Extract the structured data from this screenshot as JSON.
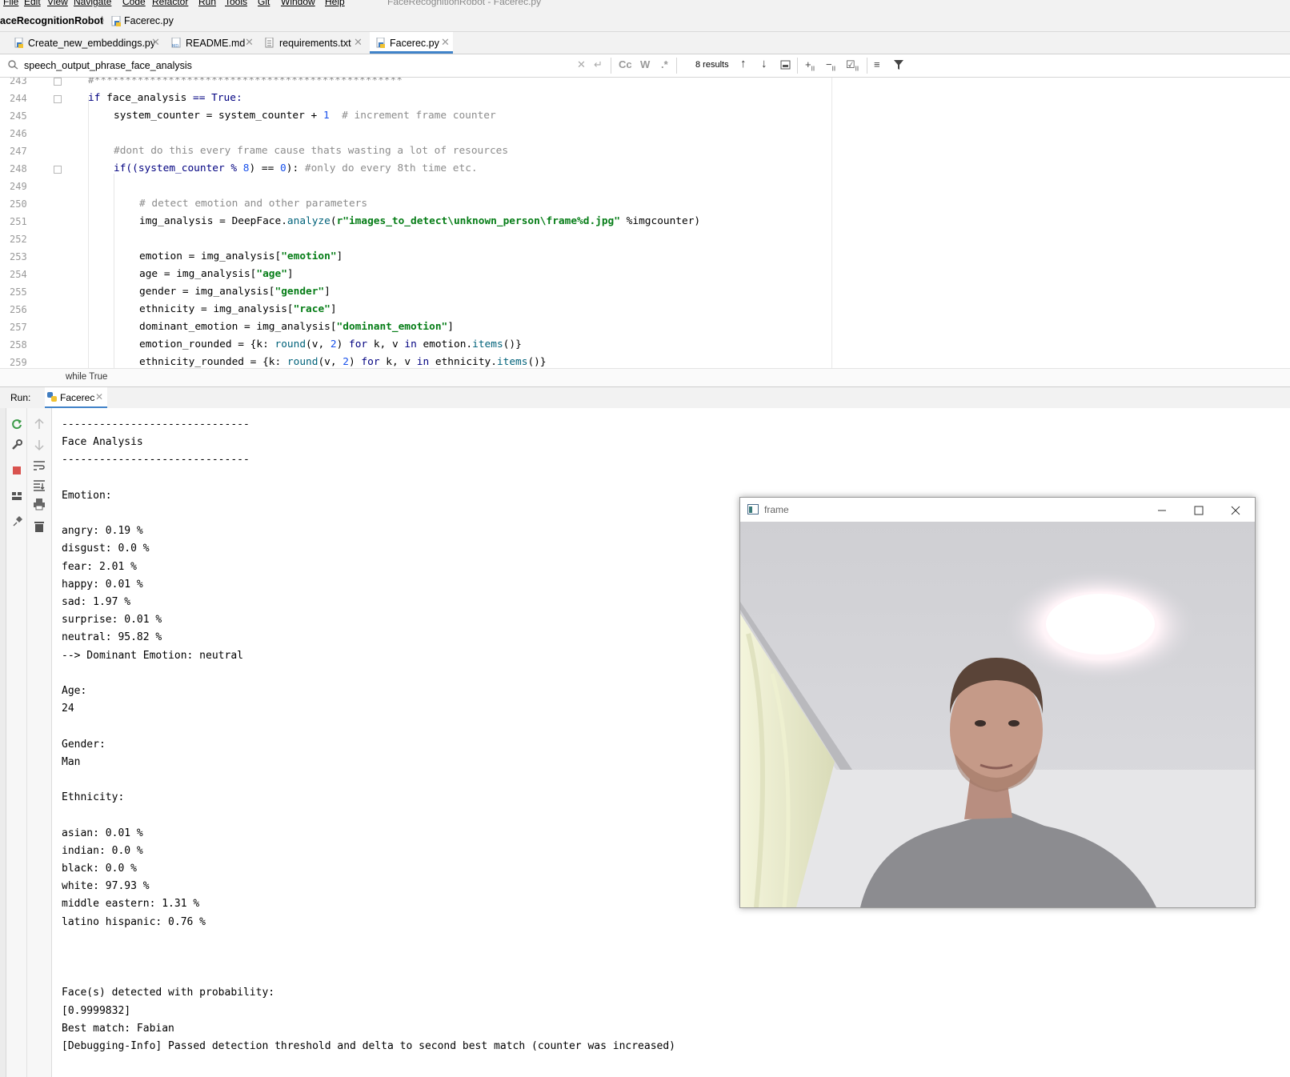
{
  "menu": {
    "items": [
      "File",
      "Edit",
      "View",
      "Navigate",
      "Code",
      "Refactor",
      "Run",
      "Tools",
      "Git",
      "Window",
      "Help"
    ],
    "window_title": "FaceRecognitionRobot - Facerec.py"
  },
  "breadcrumb": {
    "project": "aceRecognitionRobot",
    "file": "Facerec.py"
  },
  "tabs": [
    {
      "label": "Create_new_embeddings.py"
    },
    {
      "label": "README.md"
    },
    {
      "label": "requirements.txt"
    },
    {
      "label": "Facerec.py"
    }
  ],
  "search": {
    "value": "speech_output_phrase_face_analysis",
    "results": "8 results",
    "case_label": "Cc",
    "word_label": "W",
    "regex_label": ".*"
  },
  "editor": {
    "line_numbers": [
      "243",
      "244",
      "245",
      "246",
      "247",
      "248",
      "249",
      "250",
      "251",
      "252",
      "253",
      "254",
      "255",
      "256",
      "257",
      "258",
      "259"
    ],
    "lines": {
      "l243": "#**************************************************",
      "l244a": "if",
      "l244b": " face_analysis ",
      "l244c": "==",
      "l244d": " True:",
      "l245a": "system_counter = system_counter + ",
      "l245b": "1",
      "l245c": "  # increment frame counter",
      "l247": "#dont do this every frame cause thats wasting a lot of resources",
      "l248a": "if((system_counter % ",
      "l248b": "8",
      "l248c": ") == ",
      "l248d": "0",
      "l248e": "): ",
      "l248f": "#only do every 8th time etc.",
      "l250": "# detect emotion and other parameters",
      "l251a": "img_analysis = DeepFace.",
      "l251b": "analyze",
      "l251c": "(",
      "l251d": "r\"images_to_detect\\unknown_person\\frame%d.jpg\"",
      "l251e": " %imgcounter)",
      "l253a": "emotion = img_analysis[",
      "l253b": "\"emotion\"",
      "l253c": "]",
      "l254a": "age = img_analysis[",
      "l254b": "\"age\"",
      "l254c": "]",
      "l255a": "gender = img_analysis[",
      "l255b": "\"gender\"",
      "l255c": "]",
      "l256a": "ethnicity = img_analysis[",
      "l256b": "\"race\"",
      "l256c": "]",
      "l257a": "dominant_emotion = img_analysis[",
      "l257b": "\"dominant_emotion\"",
      "l257c": "]",
      "l258a": "emotion_rounded = {k: ",
      "l258b": "round",
      "l258c": "(v, ",
      "l258d": "2",
      "l258e": ") ",
      "l258f": "for",
      "l258g": " k, v ",
      "l258h": "in",
      "l258i": " emotion.",
      "l258j": "items",
      "l258k": "()}",
      "l259a": "ethnicity_rounded = {k: ",
      "l259b": "round",
      "l259c": "(v, ",
      "l259d": "2",
      "l259e": ") ",
      "l259f": "for",
      "l259g": " k, v ",
      "l259h": "in",
      "l259i": " ethnicity.",
      "l259j": "items",
      "l259k": "()}"
    },
    "status_context": "while True"
  },
  "run": {
    "label": "Run:",
    "tab": "Facerec"
  },
  "console": {
    "lines": [
      "------------------------------",
      "Face Analysis",
      "------------------------------",
      "",
      "Emotion:",
      "",
      "angry: 0.19 %",
      "disgust: 0.0 %",
      "fear: 2.01 %",
      "happy: 0.01 %",
      "sad: 1.97 %",
      "surprise: 0.01 %",
      "neutral: 95.82 %",
      "--> Dominant Emotion: neutral",
      "",
      "Age:",
      "24",
      "",
      "Gender:",
      "Man",
      "",
      "Ethnicity:",
      "",
      "asian: 0.01 %",
      "indian: 0.0 %",
      "black: 0.0 %",
      "white: 97.93 %",
      "middle eastern: 1.31 %",
      "latino hispanic: 0.76 %",
      "",
      "",
      "",
      "Face(s) detected with probability:",
      "[0.9999832]",
      "Best match: Fabian",
      "[Debugging-Info] Passed detection threshold and delta to second best match (counter was increased)"
    ]
  },
  "frame_window": {
    "title": "frame"
  },
  "colors": {
    "accent": "#4083c9",
    "keyword": "#000080",
    "string": "#067d17",
    "comment": "#8c8c8c",
    "number": "#1750eb"
  }
}
